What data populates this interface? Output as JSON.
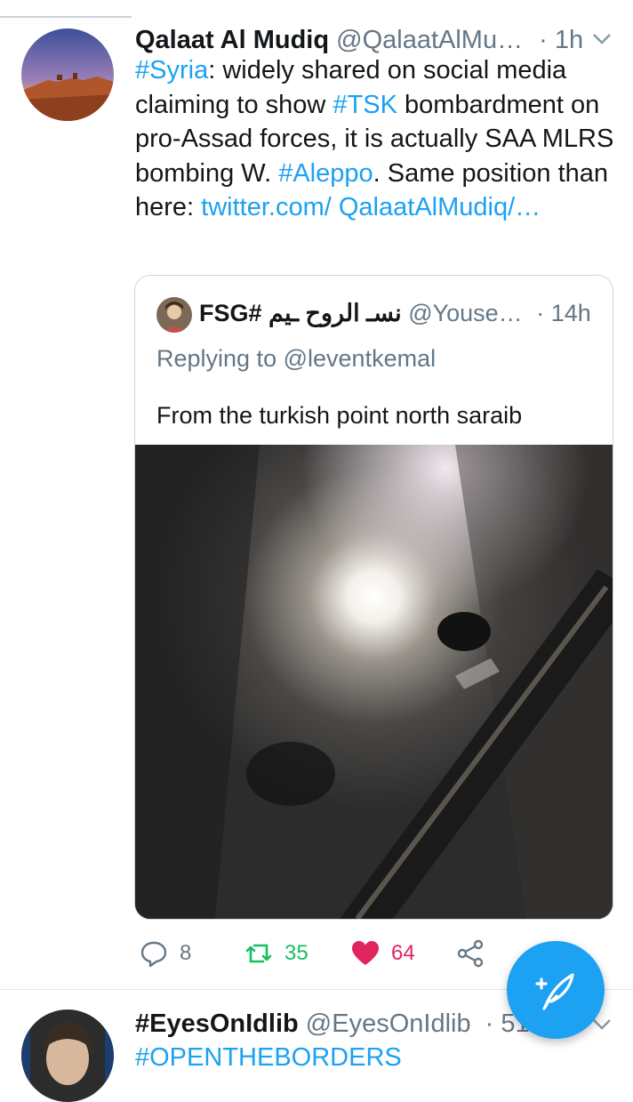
{
  "tweet": {
    "name": "Qalaat Al Mudiq",
    "handle": "@QalaatAlMu…",
    "time": "· 1h",
    "text_parts": {
      "t1": "#Syria",
      "t2": ": widely shared on social media claiming to show ",
      "t3": "#TSK",
      "t4": " bombardment on pro-Assad forces, it is actually SAA MLRS bombing W. ",
      "t5": "#Aleppo",
      "t6": ". Same position than here: ",
      "t7": "twitter.com/ QalaatAlMudiq/…"
    },
    "quote": {
      "name": "FSG# نسـ الروح ـيم",
      "handle": "@Youse…",
      "time": "· 14h",
      "replying_label": "Replying to",
      "replying_handle": "@leventkemal",
      "text": "From the turkish point north saraib"
    },
    "actions": {
      "replies": "8",
      "retweets": "35",
      "likes": "64"
    },
    "colors": {
      "accent": "#1da1f2",
      "retweet": "#17bf63",
      "like": "#e0245e"
    }
  },
  "next_tweet": {
    "name": "#EyesOnIdlib",
    "handle": "@EyesOnIdlib",
    "time": "· 51m",
    "text": "#OPENTHEBORDERS"
  }
}
